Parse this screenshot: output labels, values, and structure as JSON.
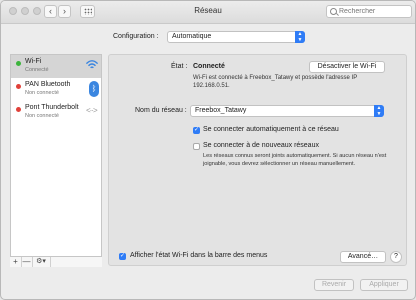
{
  "window": {
    "title": "Réseau",
    "search_placeholder": "Rechercher"
  },
  "config": {
    "label": "Configuration :",
    "value": "Automatique"
  },
  "sidebar": {
    "items": [
      {
        "name": "Wi-Fi",
        "status": "Connecté",
        "status_color": "#3cb43c",
        "icon": "wifi-icon"
      },
      {
        "name": "PAN Bluetooth",
        "status": "Non connecté",
        "status_color": "#e0413a",
        "icon": "bluetooth-icon"
      },
      {
        "name": "Pont Thunderbolt",
        "status": "Non connecté",
        "status_color": "#e0413a",
        "icon": "thunderbolt-bridge-icon"
      }
    ],
    "toolbar": {
      "add": "+",
      "remove": "—",
      "gear": "⚙▾"
    }
  },
  "status": {
    "label": "État :",
    "value": "Connecté",
    "disable_button": "Désactiver le Wi-Fi",
    "description": "Wi-Fi est connecté à Freebox_Tatawy et possède l'adresse IP 192.168.0.51."
  },
  "network_name": {
    "label": "Nom du réseau :",
    "value": "Freebox_Tatawy"
  },
  "options": {
    "auto_join_label": "Se connecter automatiquement à ce réseau",
    "auto_join_checked": true,
    "ask_label": "Se connecter à de nouveaux réseaux",
    "ask_checked": false,
    "ask_description": "Les réseaux connus seront joints automatiquement. Si aucun réseau n'est joignable, vous devrez sélectionner un réseau manuellement."
  },
  "show_status": {
    "label": "Afficher l'état Wi-Fi dans la barre des menus",
    "checked": true
  },
  "buttons": {
    "advanced": "Avancé…",
    "help": "?",
    "revert": "Revenir",
    "apply": "Appliquer"
  },
  "colors": {
    "accent": "#2f7cf6",
    "connected": "#3cb43c",
    "disconnected": "#e0413a"
  }
}
